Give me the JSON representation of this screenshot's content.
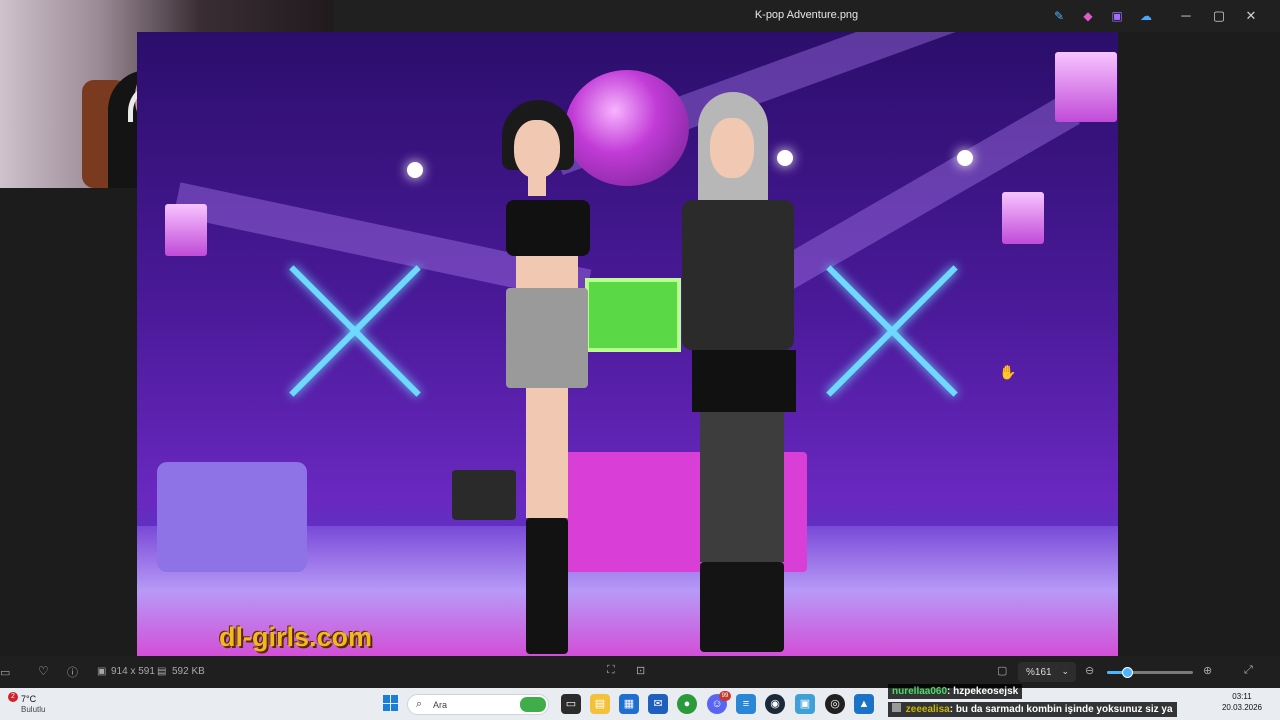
{
  "window": {
    "title": "K-pop Adventure.png",
    "toolbar_icons": [
      "edit-icon",
      "designer-icon",
      "clipchamp-icon",
      "onedrive-icon"
    ],
    "controls": {
      "minimize": "─",
      "maximize": "▢",
      "close": "✕"
    }
  },
  "image": {
    "watermark": "dl-girls.com"
  },
  "statusbar": {
    "dimensions": "914 x 591",
    "file_size": "592 KB",
    "zoom": "%161",
    "zoom_level": 0.23
  },
  "taskbar": {
    "weather_badge": "2",
    "temperature": "7°C",
    "condition": "Bulutlu",
    "search_placeholder": "Ara",
    "time": "03:11",
    "date": "20.03.2026",
    "apps": [
      "windows-start",
      "search",
      "desktop-widget",
      "task-view",
      "file-explorer",
      "microsoft-store",
      "outlook",
      "chrome",
      "discord",
      "notepad",
      "steam",
      "control-panel",
      "obs",
      "photos"
    ],
    "discord_badge": "99"
  },
  "chat": {
    "messages": [
      {
        "user": "nurellaa060",
        "text": ": hzpekeosejsk",
        "user_color": "#4cd964"
      },
      {
        "user": "zeeealisa",
        "text": ": bu da sarmadı kombin işinde yoksunuz siz ya",
        "user_color": "#c9b600"
      }
    ]
  },
  "colors": {
    "accent": "#4fb3ff",
    "title_bar": "#202020",
    "taskbar": "#e9ecf1"
  }
}
